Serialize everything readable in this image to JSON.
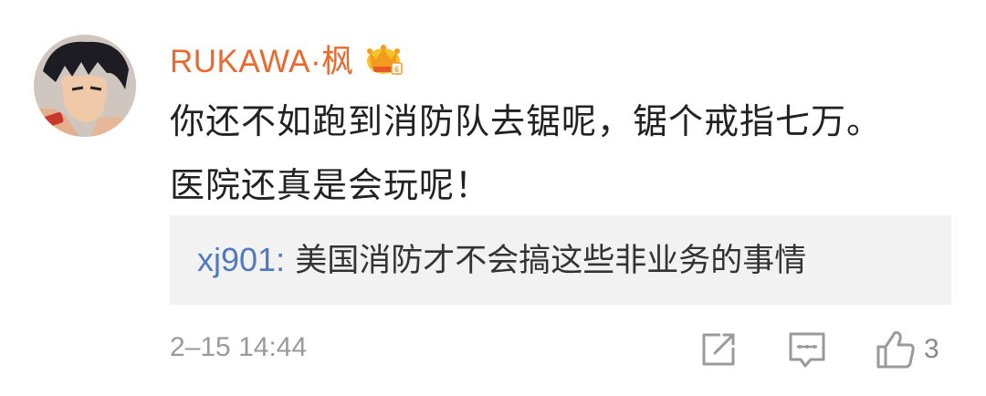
{
  "comment": {
    "username": "RUKAWA·枫",
    "badge_icon": "crown-vip-icon",
    "text": "你还不如跑到消防队去锯呢，锯个戒指七万。医院还真是会玩呢！",
    "reply": {
      "user": "xj901:",
      "text": " 美国消防才不会搞这些非业务的事情"
    },
    "timestamp": "2–15 14:44",
    "actions": {
      "share_icon": "share-edit-icon",
      "comment_icon": "comment-icon",
      "like_icon": "thumbs-up-icon",
      "like_count": "3"
    },
    "colors": {
      "username": "#e86a2f",
      "reply_user": "#4f7bbd",
      "reply_bg": "#f2f2f2",
      "meta": "#9a9a9a"
    }
  }
}
